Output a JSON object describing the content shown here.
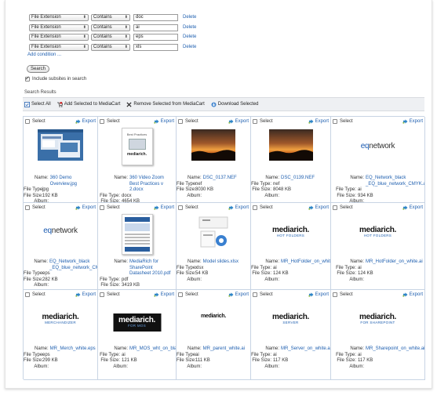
{
  "conditions": [
    {
      "field": "File Extension",
      "op": "Contains",
      "value": "doc",
      "delete": "Delete"
    },
    {
      "field": "File Extension",
      "op": "Contains",
      "value": "ai",
      "delete": "Delete"
    },
    {
      "field": "File Extension",
      "op": "Contains",
      "value": "eps",
      "delete": "Delete"
    },
    {
      "field": "File Extension",
      "op": "Contains",
      "value": "xls",
      "delete": "Delete"
    }
  ],
  "add_condition": "Add condition ...",
  "search_button": "Search",
  "include_subsites": {
    "label": "Include subsites in search",
    "checked": true
  },
  "results_label": "Search Results",
  "toolbar": {
    "select_all": "Select All",
    "add_selected": "Add Selected to MediaCart",
    "remove_selected": "Remove Selected from MediaCart",
    "download_selected": "Download Selected"
  },
  "labels": {
    "select": "Select",
    "export": "Export",
    "name": "Name:",
    "file_type": "File Type:",
    "file_size": "File Size:",
    "album": "Album:"
  },
  "results": [
    {
      "name": "360 Demo Overview.jpg",
      "type": "jpg",
      "size": "192 KB",
      "thumb": "screenshot"
    },
    {
      "name": "360 Video Zoom Best Practices v 2.docx",
      "type": "docx",
      "size": "4654 KB",
      "thumb": "document"
    },
    {
      "name": "DSC_0137.NEF",
      "type": "nef",
      "size": "8030 KB",
      "thumb": "sunset"
    },
    {
      "name": "DSC_0139.NEF",
      "type": "nef",
      "size": "8048 KB",
      "thumb": "sunset"
    },
    {
      "name": "EQ_Network_black _EQ_blue_network_CMYK.ai",
      "type": "ai",
      "size": "934 KB",
      "thumb": "eqnetwork"
    },
    {
      "name": "EQ_Network_black _EQ_blue_network_CMYK.eps",
      "type": "eps",
      "size": "282 KB",
      "thumb": "eqnetwork"
    },
    {
      "name": "MediaRich for SharePoint Datasheet 2010.pdf",
      "type": "pdf",
      "size": "3419 KB",
      "thumb": "datasheet"
    },
    {
      "name": "Model slides.xlsx",
      "type": "xlsx",
      "size": "54 KB",
      "thumb": "slides"
    },
    {
      "name": "MR_HotFolder_on_white.ai",
      "type": "ai",
      "size": "124 KB",
      "thumb": "mediarich",
      "sub": "HOT FOLDERS"
    },
    {
      "name": "MR_HotFolder_on_white.ai",
      "type": "ai",
      "size": "124 KB",
      "thumb": "mediarich",
      "sub": "HOT FOLDERS"
    },
    {
      "name": "MR_Merch_white.eps",
      "type": "eps",
      "size": "299 KB",
      "thumb": "mediarich",
      "sub": "MERCHANDIZER"
    },
    {
      "name": "MR_MOS_wht_on_black.ai",
      "type": "ai",
      "size": "121 KB",
      "thumb": "mediarich-dark",
      "sub": "FOR MOS"
    },
    {
      "name": "MR_parent_white.ai",
      "type": "ai",
      "size": "111 KB",
      "thumb": "mediarich-small",
      "sub": ""
    },
    {
      "name": "MR_Server_on_white.ai",
      "type": "ai",
      "size": "117 KB",
      "thumb": "mediarich",
      "sub": "SERVER"
    },
    {
      "name": "MR_Sharepoint_on_white.ai",
      "type": "ai",
      "size": "117 KB",
      "thumb": "mediarich",
      "sub": "FOR SHAREPOINT"
    }
  ],
  "thumb_text": {
    "eqnetwork_eq": "eq",
    "eqnetwork_rest": "network",
    "mediarich": "mediarich.",
    "document_title": "Best Practices"
  },
  "colors": {
    "link": "#2060b0",
    "grid_border": "#c8d4e4",
    "toolbar_bg": "#eef0f3"
  }
}
